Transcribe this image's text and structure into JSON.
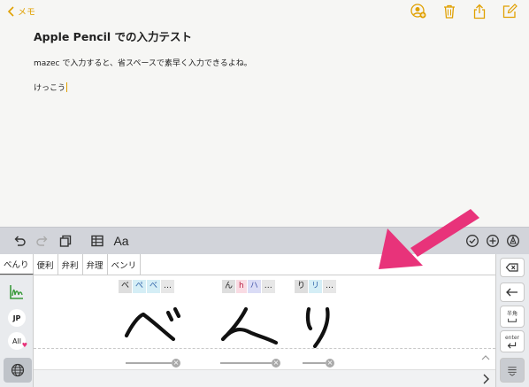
{
  "nav": {
    "back_label": "メモ"
  },
  "note": {
    "title": "Apple Pencil での入力テスト",
    "line1": "mazec で入力すると、省スペースで素早く入力できるよね。",
    "line2": "けっこう"
  },
  "toolbar": {
    "format_label": "Aa"
  },
  "candidates": [
    "べんり",
    "便利",
    "弁利",
    "弁理",
    "ベンリ"
  ],
  "handwriting": {
    "groups": [
      {
        "tags": [
          "ベ",
          "ぺ",
          "べ",
          "…"
        ]
      },
      {
        "tags": [
          "ん",
          "h",
          "ハ",
          "…"
        ]
      },
      {
        "tags": [
          "り",
          "リ",
          "…"
        ]
      }
    ]
  },
  "left_panel": {
    "jp_label": "JP",
    "all_label": "All"
  },
  "right_panel": {
    "han_label": "半角",
    "enter_label": "enter"
  },
  "colors": {
    "accent": "#e0a000",
    "arrow": "#e8337a"
  }
}
